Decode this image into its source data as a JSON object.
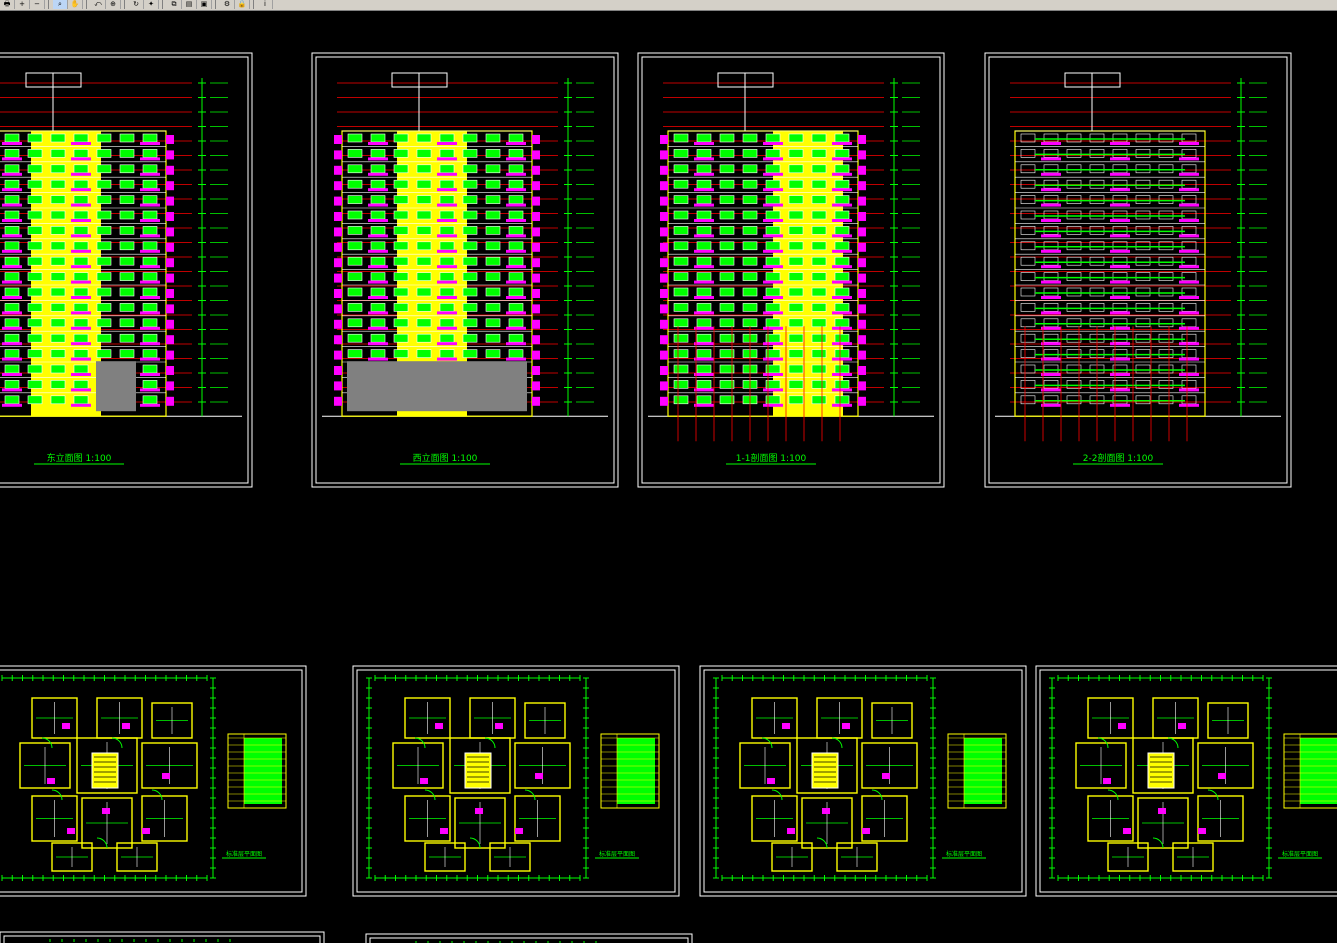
{
  "toolbar": {
    "buttons": [
      {
        "icon": "print-icon",
        "glyph": "🖶"
      },
      {
        "icon": "zoom-in-icon",
        "glyph": "+"
      },
      {
        "icon": "zoom-out-icon",
        "glyph": "−"
      },
      {
        "icon": "zoom-window-icon",
        "glyph": "⌕",
        "active": true
      },
      {
        "icon": "pan-icon",
        "glyph": "✋"
      },
      {
        "icon": "zoom-previous-icon",
        "glyph": "⤺"
      },
      {
        "icon": "zoom-extents-icon",
        "glyph": "⊕"
      },
      {
        "icon": "redraw-icon",
        "glyph": "↻"
      },
      {
        "icon": "layers-icon",
        "glyph": "✦"
      },
      {
        "icon": "copy-icon",
        "glyph": "⧉"
      },
      {
        "icon": "properties-icon",
        "glyph": "▤"
      },
      {
        "icon": "aerial-view-icon",
        "glyph": "▣"
      },
      {
        "icon": "settings-icon",
        "glyph": "⚙"
      },
      {
        "icon": "lock-icon",
        "glyph": "🔒"
      },
      {
        "icon": "info-icon",
        "glyph": "i"
      }
    ]
  },
  "drawing": {
    "colors": {
      "background": "#000000",
      "frame": "#ffffff",
      "title": "#00ff00",
      "dimension": "#00ff00",
      "level": "#ff0000",
      "facade": "#ffff00",
      "balcony": "#ff00ff",
      "window": "#00ff00",
      "wall": "#ffff00",
      "base": "#808080"
    },
    "elevations": [
      {
        "name": "elevation-sheet-east",
        "title": "东立面图  1:100"
      },
      {
        "name": "elevation-sheet-west",
        "title": "西立面图  1:100"
      },
      {
        "name": "elevation-sheet-section-1",
        "title": "1-1剖面图  1:100"
      },
      {
        "name": "elevation-sheet-section-2",
        "title": "2-2剖面图  1:100"
      }
    ],
    "plans": [
      {
        "name": "plan-sheet-1",
        "title": "标准层平面图"
      },
      {
        "name": "plan-sheet-2",
        "title": "标准层平面图"
      },
      {
        "name": "plan-sheet-3",
        "title": "标准层平面图"
      },
      {
        "name": "plan-sheet-4",
        "title": "标准层平面图"
      }
    ],
    "partial_sheets": [
      {
        "name": "partial-sheet-1"
      },
      {
        "name": "partial-sheet-2"
      }
    ]
  }
}
